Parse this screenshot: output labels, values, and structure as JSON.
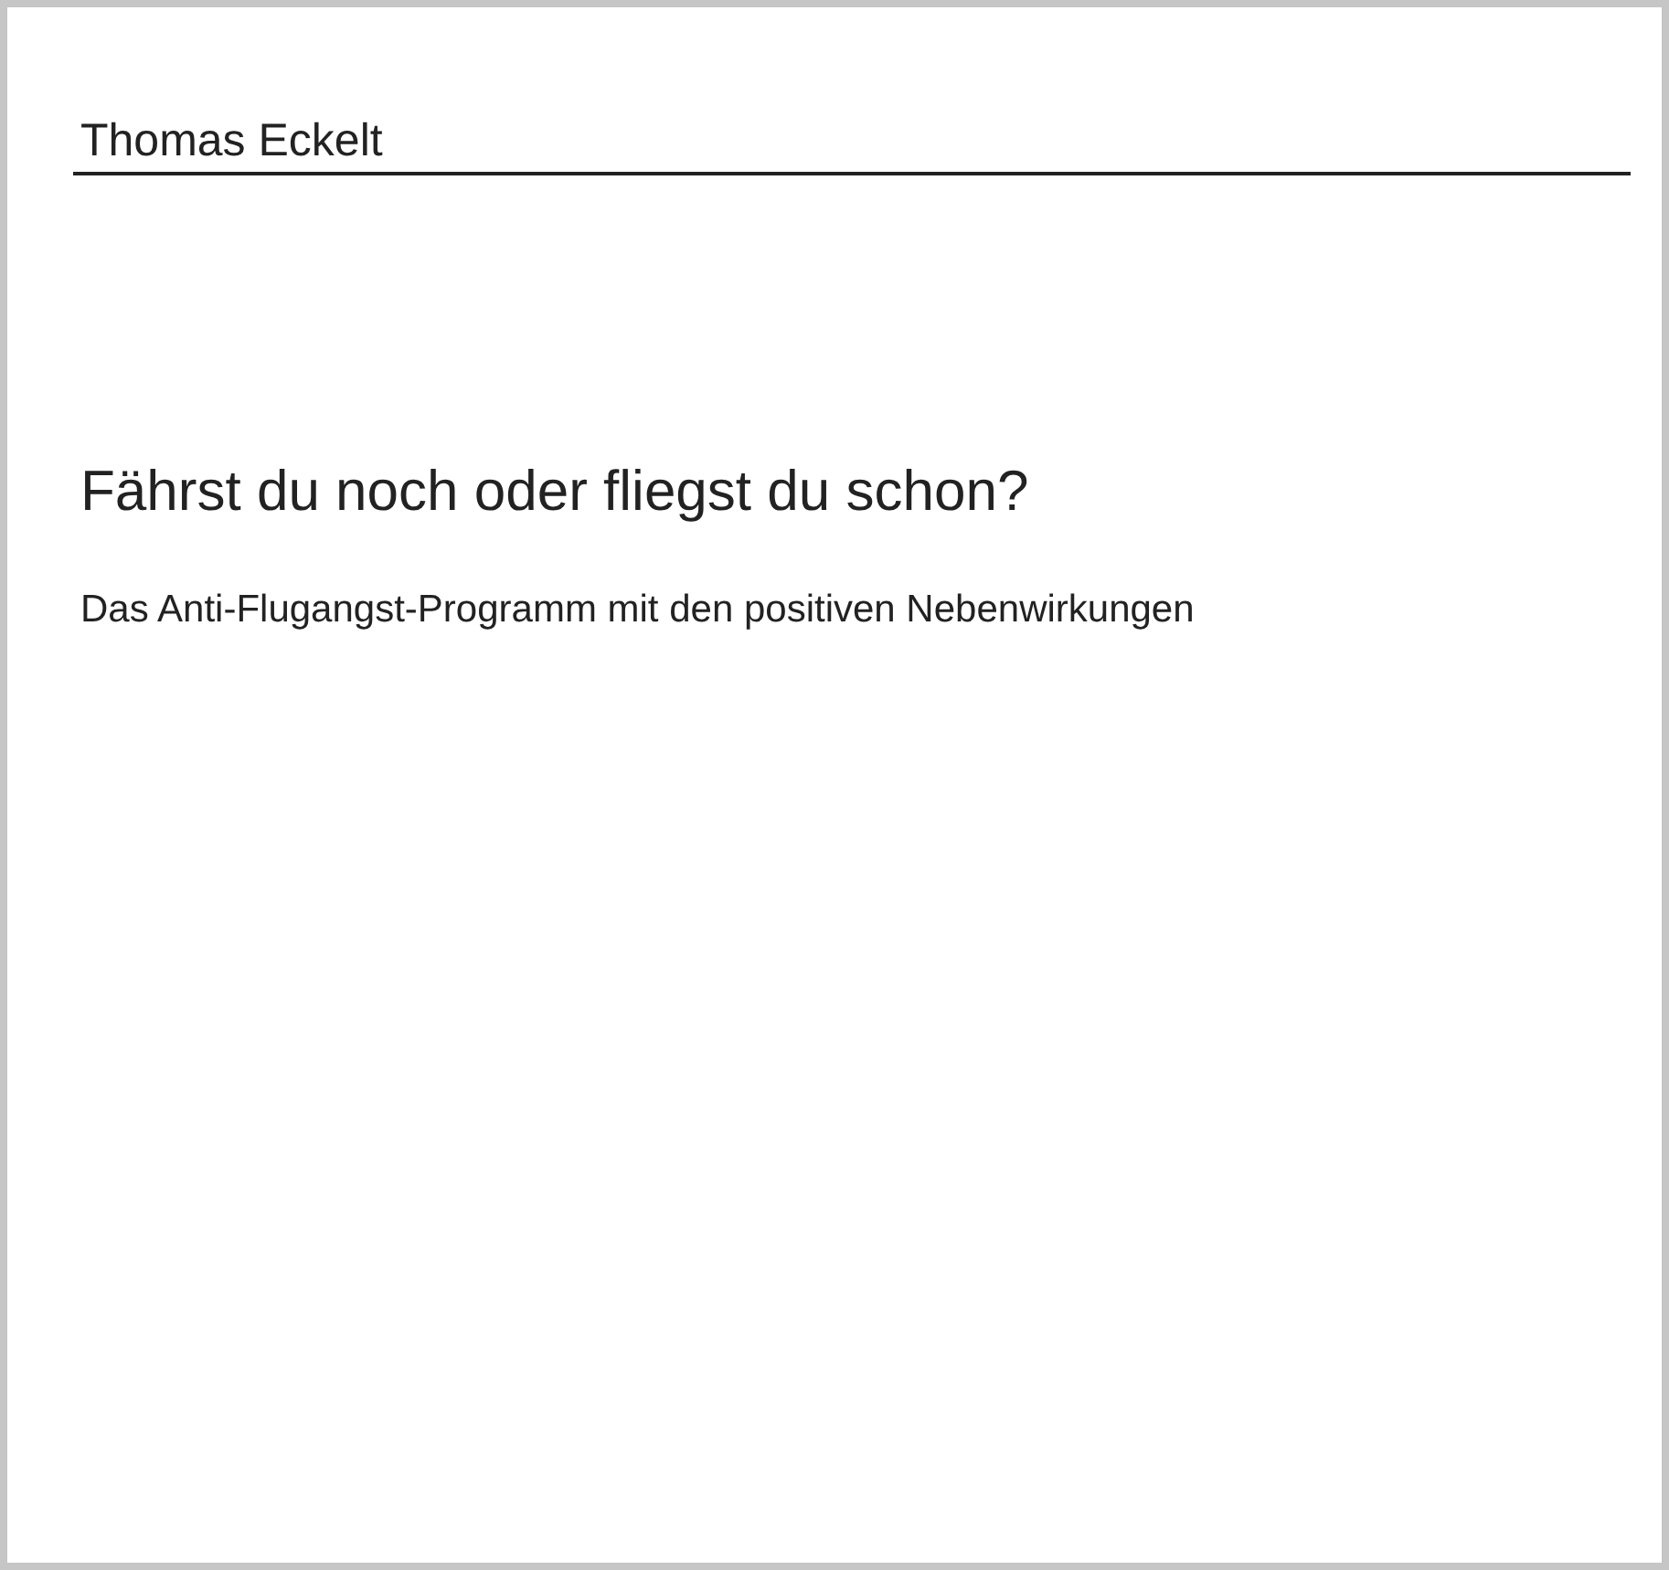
{
  "author": "Thomas Eckelt",
  "title": "Fährst du noch oder fliegst du schon?",
  "subtitle": "Das Anti-Flugangst-Programm mit den positiven Nebenwirkungen"
}
